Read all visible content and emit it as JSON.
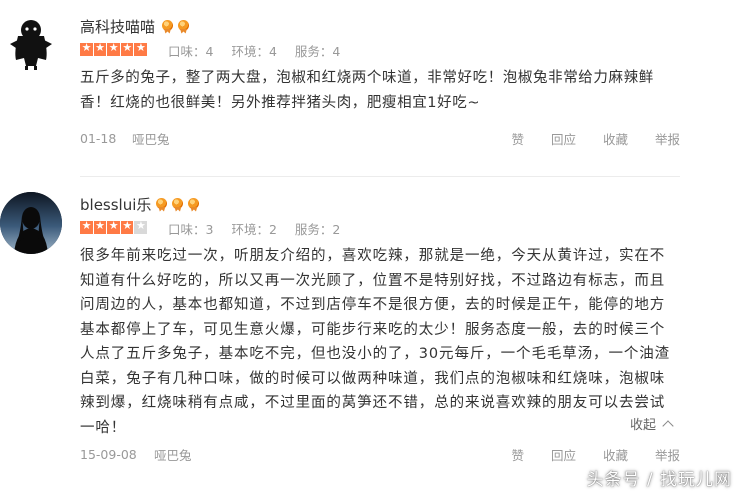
{
  "reviews": [
    {
      "username": "高科技喵喵",
      "vip_level": 2,
      "star_rating": 5,
      "scores": {
        "taste": "口味：4",
        "environment": "环境：4",
        "service": "服务：4"
      },
      "content": "五斤多的兔子，整了两大盘，泡椒和红烧两个味道，非常好吃！泡椒兔非常给力麻辣鲜香！红烧的也很鲜美！另外推荐拌猪头肉，肥瘦相宜1好吃~",
      "date": "01-18",
      "shop": "哑巴兔",
      "actions": {
        "like": "赞",
        "reply": "回应",
        "favorite": "收藏",
        "report": "举报"
      }
    },
    {
      "username": "blesslui乐",
      "vip_level": 3,
      "star_rating": 4,
      "scores": {
        "taste": "口味：3",
        "environment": "环境：2",
        "service": "服务：2"
      },
      "content": "很多年前来吃过一次，听朋友介绍的，喜欢吃辣，那就是一绝，今天从黄许过，实在不知道有什么好吃的，所以又再一次光顾了，位置不是特别好找，不过路边有标志，而且问周边的人，基本也都知道，不过到店停车不是很方便，去的时候是正午，能停的地方基本都停上了车，可见生意火爆，可能步行来吃的太少！服务态度一般，去的时候三个人点了五斤多兔子，基本吃不完，但也没小的了，30元每斤，一个毛毛草汤，一个油渣白菜，兔子有几种口味，做的时候可以做两种味道，我们点的泡椒味和红烧味，泡椒味辣到爆，红烧味稍有点咸，不过里面的莴笋还不错，总的来说喜欢辣的朋友可以去尝试一哈！",
      "collapse_label": "收起",
      "date": "15-09-08",
      "shop": "哑巴兔",
      "actions": {
        "like": "赞",
        "reply": "回应",
        "favorite": "收藏",
        "report": "举报"
      }
    }
  ],
  "watermark": "头条号 / 找玩儿网",
  "colors": {
    "star_on": "#ff7a45",
    "star_off": "#d9d9d9",
    "vip_badge": "#f59a23",
    "meta_text": "#999999"
  }
}
